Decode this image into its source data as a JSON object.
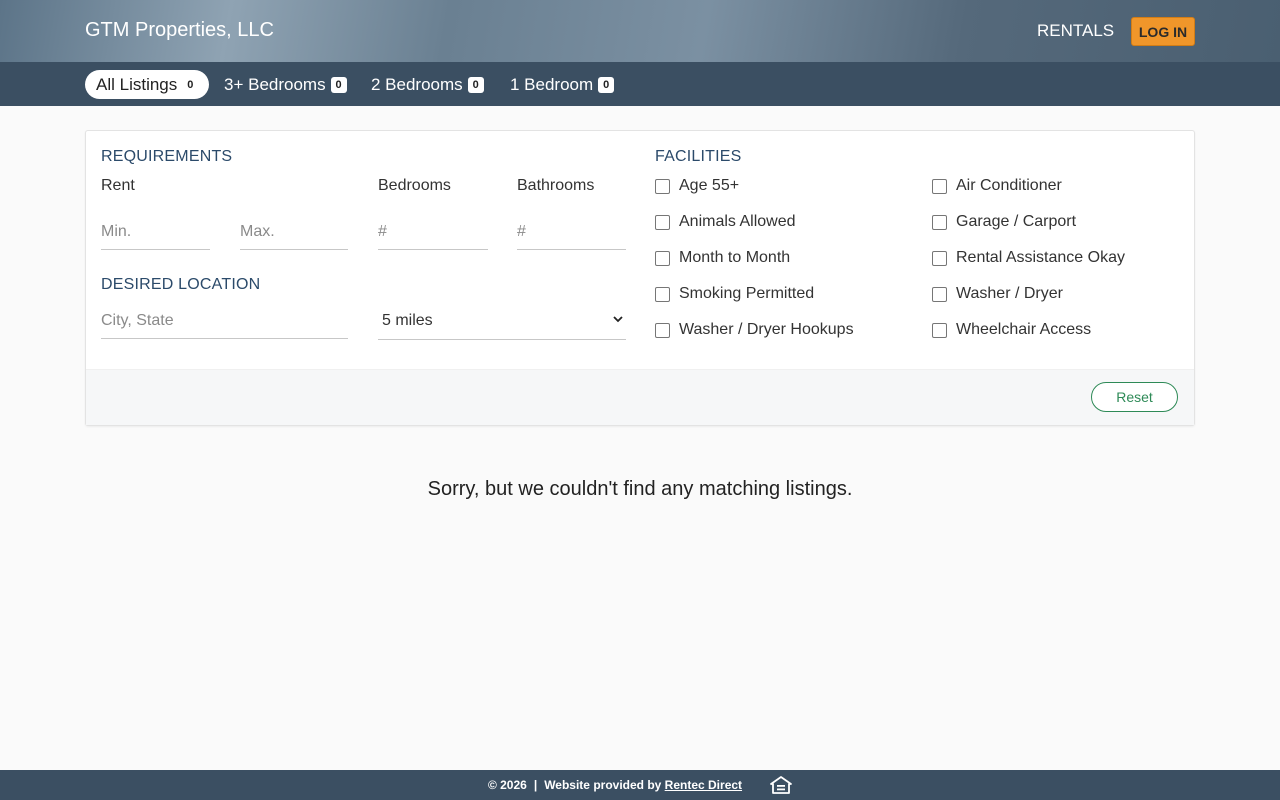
{
  "header": {
    "brand": "GTM Properties, LLC",
    "rentals_label": "RENTALS",
    "login_label": "LOG IN"
  },
  "tabs": [
    {
      "label": "All Listings",
      "count": "0",
      "active": true
    },
    {
      "label": "3+ Bedrooms",
      "count": "0",
      "active": false
    },
    {
      "label": "2 Bedrooms",
      "count": "0",
      "active": false
    },
    {
      "label": "1 Bedroom",
      "count": "0",
      "active": false
    }
  ],
  "filters": {
    "requirements_title": "REQUIREMENTS",
    "rent_label": "Rent",
    "rent_min_placeholder": "Min.",
    "rent_max_placeholder": "Max.",
    "bedrooms_label": "Bedrooms",
    "bedrooms_placeholder": "#",
    "bathrooms_label": "Bathrooms",
    "bathrooms_placeholder": "#",
    "location_title": "DESIRED LOCATION",
    "location_placeholder": "City, State",
    "radius_value": "5 miles",
    "facilities_title": "FACILITIES",
    "facilities": [
      "Age 55+",
      "Animals Allowed",
      "Month to Month",
      "Smoking Permitted",
      "Washer / Dryer Hookups",
      "Air Conditioner",
      "Garage / Carport",
      "Rental Assistance Okay",
      "Washer / Dryer",
      "Wheelchair Access"
    ],
    "reset_label": "Reset"
  },
  "results": {
    "empty_message": "Sorry, but we couldn't find any matching listings."
  },
  "footer": {
    "copyright": "© 2026",
    "separator": "|",
    "provided_by": "Website provided by",
    "provider_link": "Rentec Direct",
    "eho_icon": "equal-housing-icon"
  },
  "colors": {
    "header_bar": "#3b4f62",
    "login_accent": "#f0962a",
    "section_title": "#2b4a6a",
    "reset_accent": "#2e8a57"
  }
}
